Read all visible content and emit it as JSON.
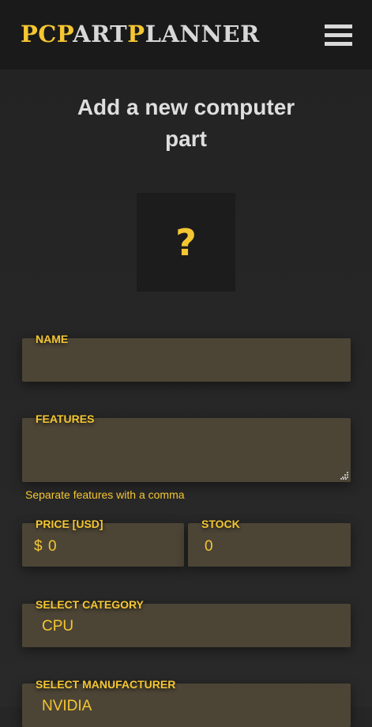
{
  "header": {
    "logo_parts": [
      "PC",
      "P",
      "ART",
      "P",
      "LANNER"
    ],
    "menu_icon": "hamburger-menu-icon"
  },
  "page": {
    "title": "Add a new computer part",
    "image_placeholder": "?"
  },
  "form": {
    "name": {
      "label": "NAME",
      "value": ""
    },
    "features": {
      "label": "FEATURES",
      "value": "",
      "hint": "Separate features with a comma"
    },
    "price": {
      "label": "PRICE [USD]",
      "currency": "$",
      "value": "0"
    },
    "stock": {
      "label": "STOCK",
      "value": "0"
    },
    "category": {
      "label": "SELECT CATEGORY",
      "value": "CPU"
    },
    "manufacturer": {
      "label": "SELECT MANUFACTURER",
      "value": "NVIDIA"
    }
  },
  "colors": {
    "accent": "#f5c632",
    "header_bg": "#1a1a1a",
    "page_bg": "#262626",
    "field_bg": "#4c4536",
    "title_text": "#dedede"
  }
}
